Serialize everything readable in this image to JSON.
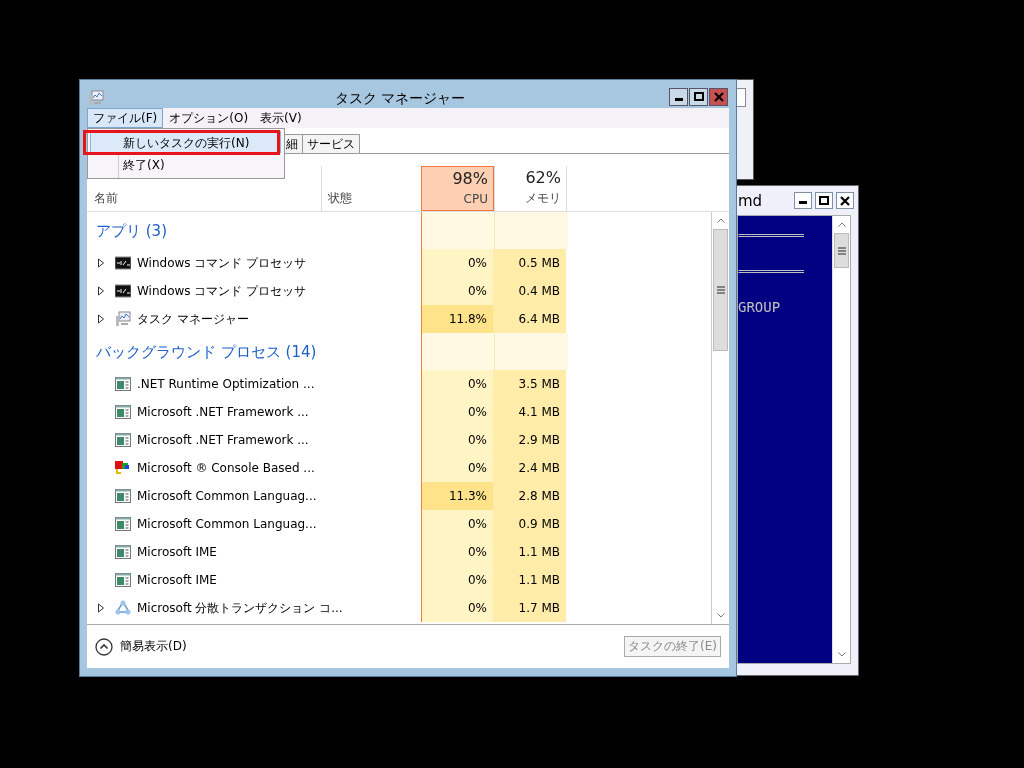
{
  "cmd_window": {
    "title": "md",
    "lines": [
      {
        "kind": "rule",
        "text": "==========="
      },
      {
        "kind": "blank"
      },
      {
        "kind": "rule",
        "text": "==========="
      },
      {
        "kind": "blank"
      },
      {
        "kind": "text",
        "text": "GROUP"
      }
    ]
  },
  "task_manager": {
    "title": "タスク マネージャー",
    "menu": [
      {
        "label": "ファイル(F)",
        "selected": true
      },
      {
        "label": "オプション(O)",
        "selected": false
      },
      {
        "label": "表示(V)",
        "selected": false
      }
    ],
    "file_menu": [
      {
        "label": "新しいタスクの実行(N)",
        "selected": true,
        "highlighted": true
      },
      {
        "label": "終了(X)",
        "selected": false,
        "highlighted": false
      }
    ],
    "tabs": [
      {
        "label": "細",
        "selected": false
      },
      {
        "label": "サービス",
        "selected": false
      }
    ],
    "columns": {
      "name": "名前",
      "status": "状態",
      "cpu": {
        "percent": "98%",
        "label": "CPU",
        "sorted": true
      },
      "memory": {
        "percent": "62%",
        "label": "メモリ",
        "sorted": false
      }
    },
    "groups": [
      {
        "title": "アプリ (3)",
        "rows": [
          {
            "name": "Windows コマンド プロセッサ",
            "kind": "console",
            "expandable": true,
            "cpu": "0%",
            "memory": "0.5 MB",
            "cpu_high": false
          },
          {
            "name": "Windows コマンド プロセッサ",
            "kind": "console",
            "expandable": true,
            "cpu": "0%",
            "memory": "0.4 MB",
            "cpu_high": false
          },
          {
            "name": "タスク マネージャー",
            "kind": "monitor",
            "expandable": true,
            "cpu": "11.8%",
            "memory": "6.4 MB",
            "cpu_high": true
          }
        ]
      },
      {
        "title": "バックグラウンド プロセス (14)",
        "rows": [
          {
            "name": ".NET Runtime Optimization ...",
            "kind": "app",
            "expandable": false,
            "cpu": "0%",
            "memory": "3.5 MB",
            "cpu_high": false
          },
          {
            "name": "Microsoft .NET Framework ...",
            "kind": "app",
            "expandable": false,
            "cpu": "0%",
            "memory": "4.1 MB",
            "cpu_high": false
          },
          {
            "name": "Microsoft .NET Framework ...",
            "kind": "app",
            "expandable": false,
            "cpu": "0%",
            "memory": "2.9 MB",
            "cpu_high": false
          },
          {
            "name": "Microsoft ® Console Based ...",
            "kind": "colorful",
            "expandable": false,
            "cpu": "0%",
            "memory": "2.4 MB",
            "cpu_high": false
          },
          {
            "name": "Microsoft Common Languag...",
            "kind": "app",
            "expandable": false,
            "cpu": "11.3%",
            "memory": "2.8 MB",
            "cpu_high": true
          },
          {
            "name": "Microsoft Common Languag...",
            "kind": "app",
            "expandable": false,
            "cpu": "0%",
            "memory": "0.9 MB",
            "cpu_high": false
          },
          {
            "name": "Microsoft IME",
            "kind": "app",
            "expandable": false,
            "cpu": "0%",
            "memory": "1.1 MB",
            "cpu_high": false
          },
          {
            "name": "Microsoft IME",
            "kind": "app",
            "expandable": false,
            "cpu": "0%",
            "memory": "1.1 MB",
            "cpu_high": false
          },
          {
            "name": "Microsoft 分散トランザクション コ...",
            "kind": "network",
            "expandable": true,
            "cpu": "0%",
            "memory": "1.7 MB",
            "cpu_high": false
          }
        ]
      }
    ],
    "footer": {
      "toggle": "簡易表示(D)",
      "end_task": {
        "label": "タスクの終了(E)",
        "disabled": true
      }
    }
  }
}
